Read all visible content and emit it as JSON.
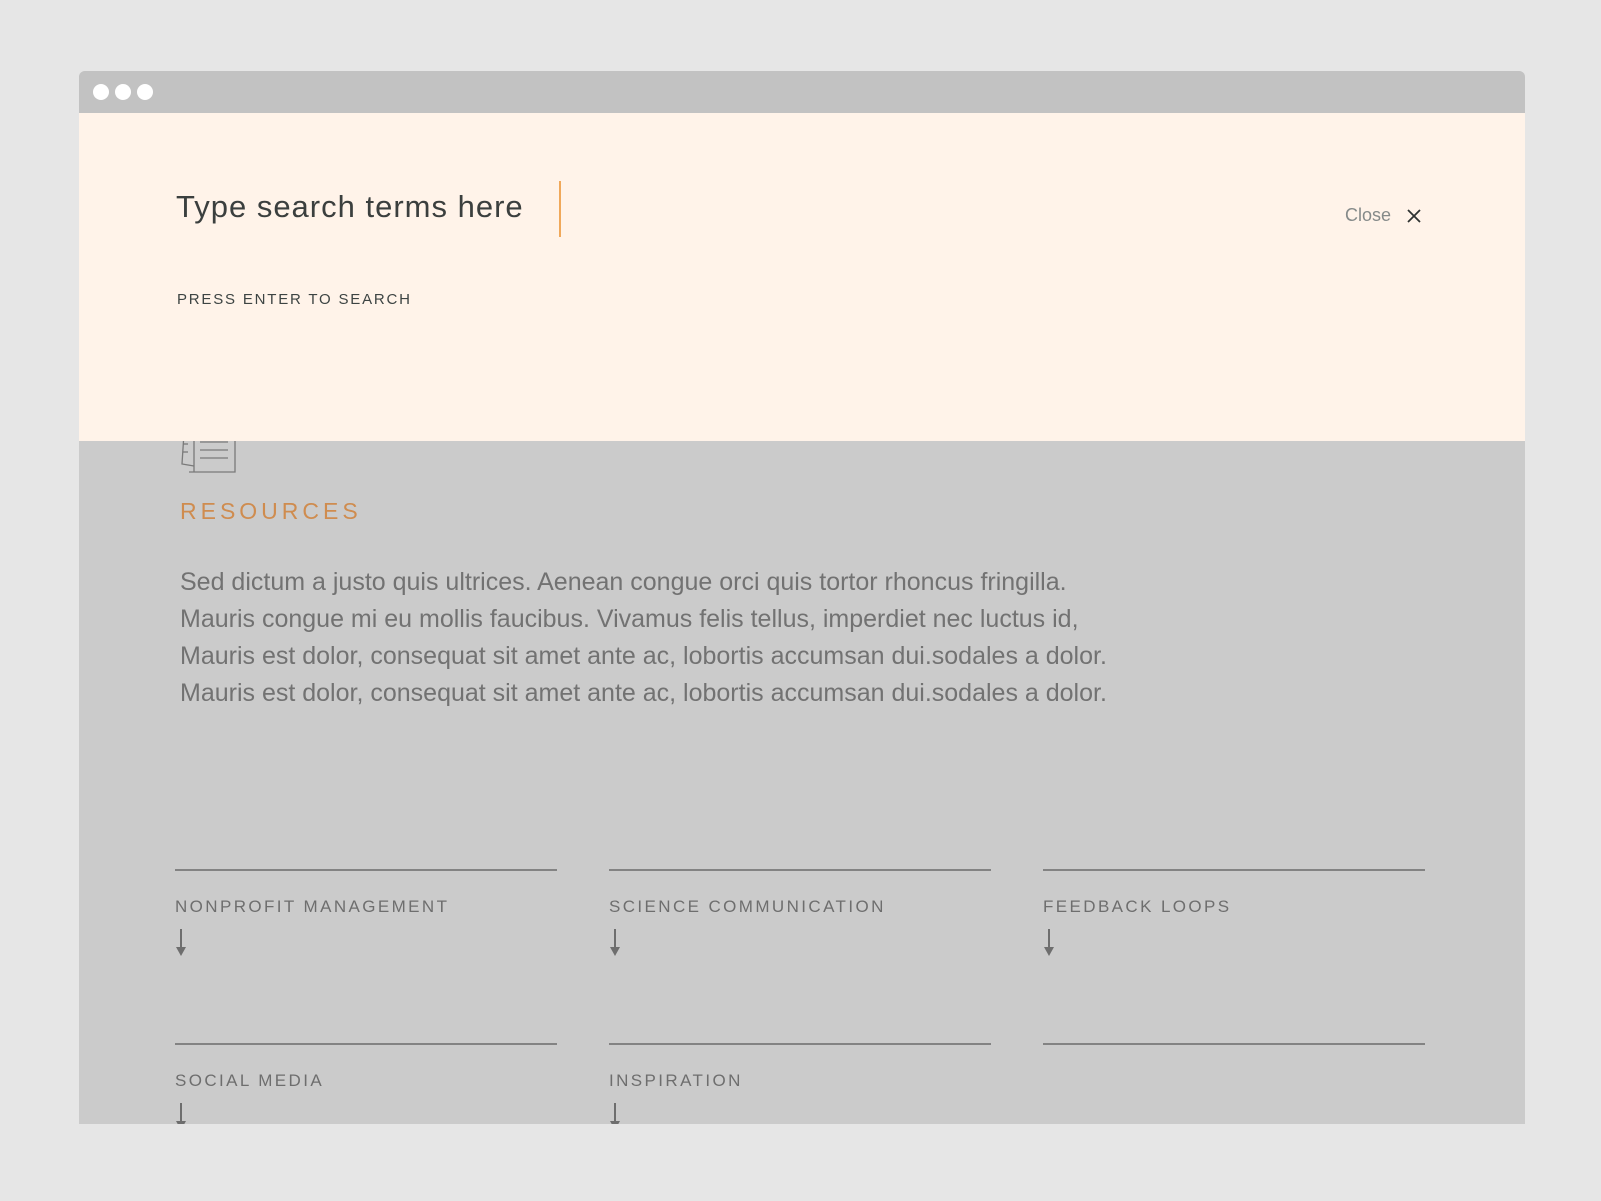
{
  "window": {
    "controls": [
      "dot-1",
      "dot-2",
      "dot-3"
    ]
  },
  "search": {
    "placeholder": "Type search terms here",
    "value": "",
    "hint": "PRESS ENTER TO SEARCH",
    "close_label": "Close",
    "close_icon": "close-icon",
    "accent_color": "#f0a85a",
    "overlay_color": "#fff3e9"
  },
  "page": {
    "section_icon": "documents-icon",
    "section_title": "RESOURCES",
    "section_title_color": "#cf8c4f",
    "intro": "Sed dictum a justo quis ultrices. Aenean congue orci quis tortor rhoncus fringilla. Mauris congue mi eu mollis faucibus. Vivamus felis tellus, imperdiet nec luctus id, Mauris est dolor, consequat sit amet ante ac, lobortis accumsan dui.sodales a dolor. Mauris est dolor, consequat sit amet ante ac, lobortis accumsan dui.sodales a dolor.",
    "topics": [
      {
        "label": "NONPROFIT MANAGEMENT",
        "icon": "arrow-down-icon"
      },
      {
        "label": "SCIENCE COMMUNICATION",
        "icon": "arrow-down-icon"
      },
      {
        "label": "FEEDBACK LOOPS",
        "icon": "arrow-down-icon"
      },
      {
        "label": "SOCIAL MEDIA",
        "icon": "arrow-down-icon"
      },
      {
        "label": "INSPIRATION",
        "icon": "arrow-down-icon"
      },
      {
        "label": "",
        "icon": ""
      }
    ]
  }
}
